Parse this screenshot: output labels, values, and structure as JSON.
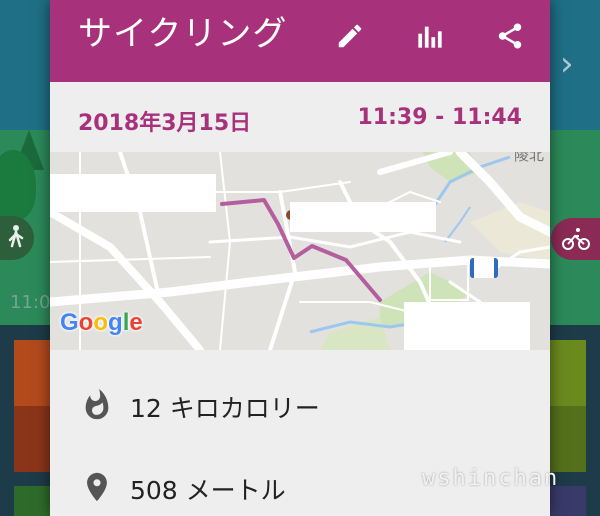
{
  "dialog": {
    "title": "サイクリング",
    "date": "2018年3月15日",
    "time_range": "11:39 - 11:44"
  },
  "icons": {
    "edit": "pencil-icon",
    "stats": "bar-chart-icon",
    "share": "share-icon",
    "calories": "flame-icon",
    "distance": "location-pin-icon"
  },
  "map": {
    "provider_logo": "Google",
    "map_label": "陵北"
  },
  "stats": {
    "calories": "12 キロカロリー",
    "distance": "508 メートル"
  },
  "background": {
    "time_fragment": "11:0"
  },
  "watermark": "wshinchan",
  "colors": {
    "accent": "#a8317c",
    "route": "#b45d9f"
  }
}
